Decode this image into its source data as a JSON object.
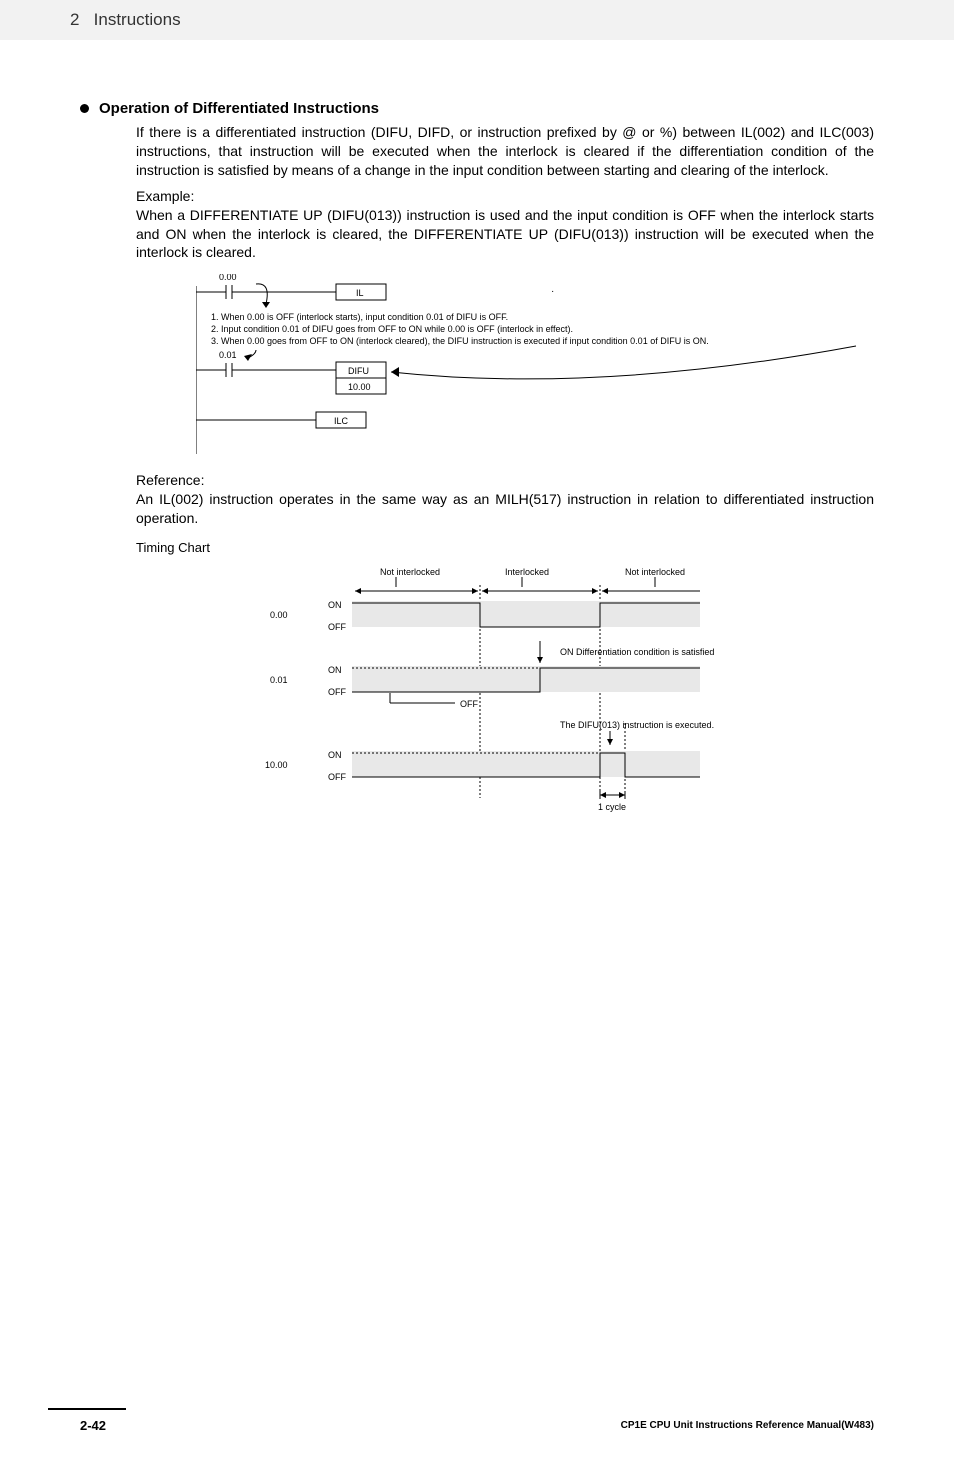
{
  "header": {
    "chapter_num": "2",
    "chapter_title": "Instructions"
  },
  "section": {
    "heading": "Operation of Differentiated Instructions",
    "p1": "If there is a differentiated instruction (DIFU, DIFD, or instruction prefixed by @ or %) between IL(002) and ILC(003) instructions, that instruction will be executed when the interlock is cleared if the differentiation condition of the instruction is satisfied by means of a change in the input condition between starting and clearing of the interlock.",
    "example_label": "Example:",
    "example_text": "When a DIFFERENTIATE UP (DIFU(013)) instruction is used and the input condition is OFF when the interlock starts and ON when the interlock is cleared, the DIFFERENTIATE UP (DIFU(013)) instruction will be executed when the interlock is cleared.",
    "reference_label": "Reference:",
    "reference_text": "An IL(002) instruction operates in the same way as an MILH(517) instruction in relation to differentiated instruction operation.",
    "timing_label": "Timing Chart"
  },
  "ladder": {
    "contact1": "0.00",
    "box_il": "IL",
    "note1": "1. When 0.00 is OFF (interlock starts), input condition 0.01 of DIFU is OFF.",
    "note2": "2. Input condition 0.01 of DIFU goes from OFF to ON while 0.00 is OFF (interlock in effect).",
    "note3": "3. When 0.00 goes from OFF to ON (interlock cleared), the DIFU instruction is executed if input condition 0.01 of DIFU is ON.",
    "contact2": "0.01",
    "box_difu": "DIFU",
    "box_addr": "10.00",
    "box_ilc": "ILC"
  },
  "chart_data": {
    "type": "timing",
    "regions": [
      "Not interlocked",
      "Interlocked",
      "Not interlocked"
    ],
    "signals": [
      {
        "name": "0.00",
        "on_label": "ON",
        "off_label": "OFF"
      },
      {
        "name": "0.01",
        "on_label": "ON",
        "off_label": "OFF",
        "annot_on": "ON  Differentiation condition is satisfied",
        "annot_off": "OFF"
      },
      {
        "name": "10.00",
        "on_label": "ON",
        "off_label": "OFF",
        "annot": "The DIFU(013) instruction is executed."
      }
    ],
    "cycle_label": "1 cycle"
  },
  "footer": {
    "page": "2-42",
    "manual": "CP1E CPU Unit Instructions Reference Manual(W483)"
  }
}
